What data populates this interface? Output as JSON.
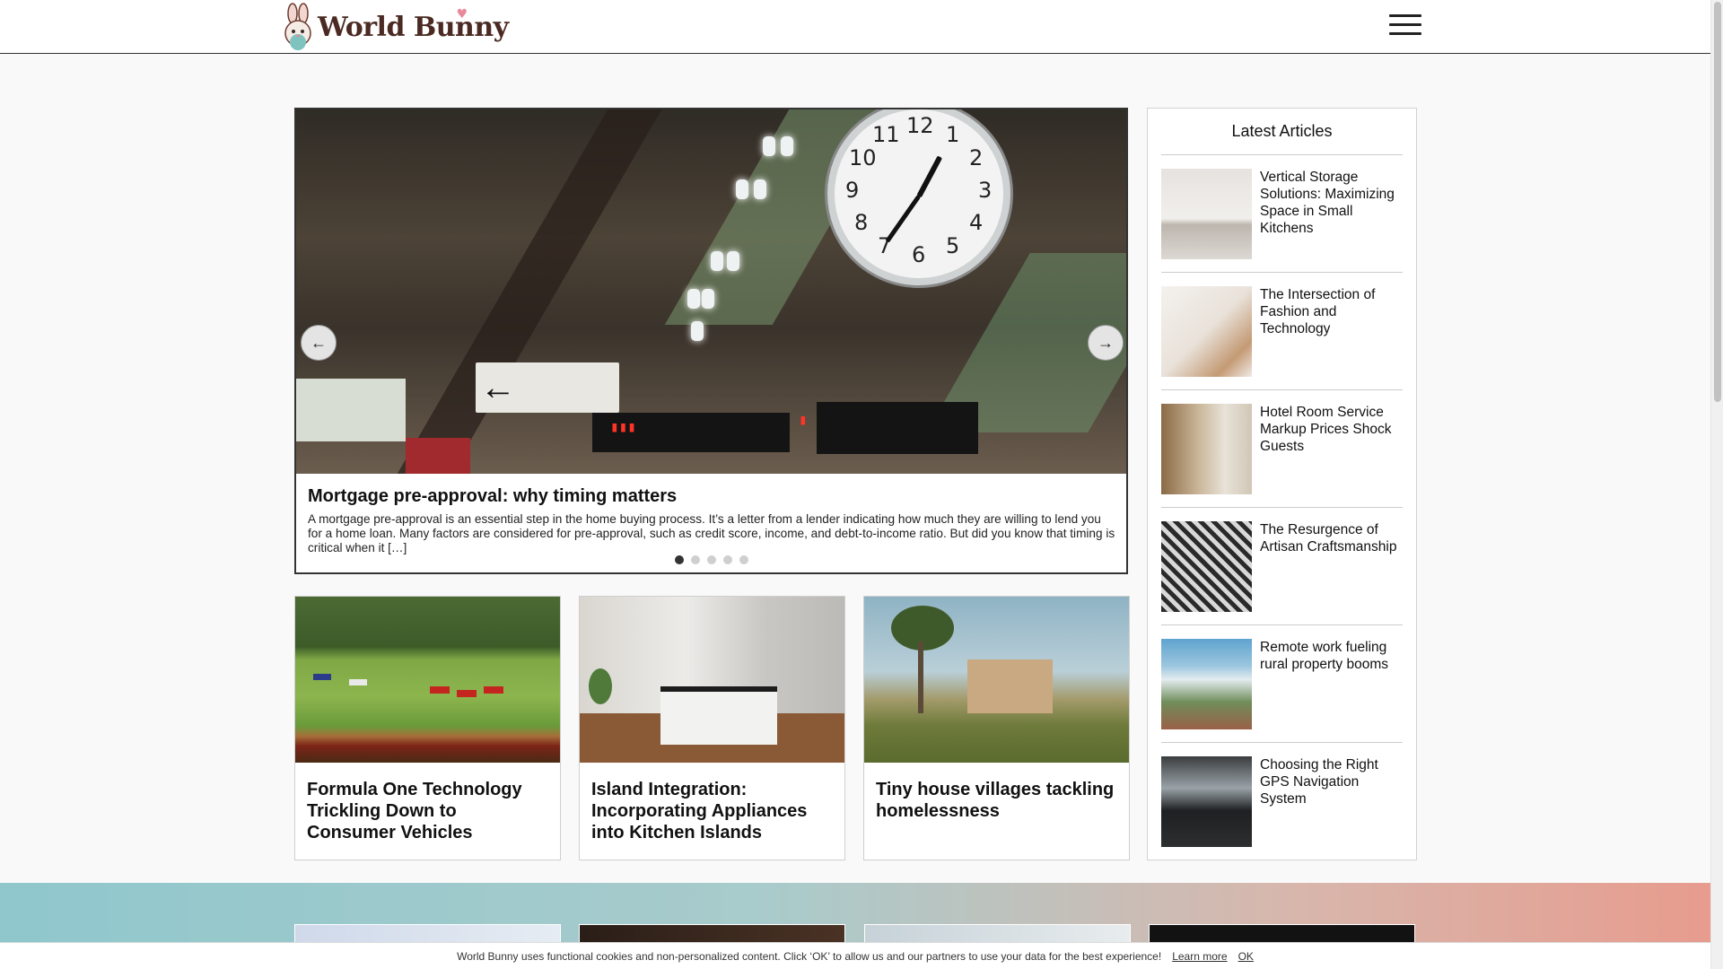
{
  "site": {
    "logo_text": "World Bunny",
    "menu_icon": "hamburger-menu-icon"
  },
  "slider": {
    "prev_label": "←",
    "next_label": "→",
    "title": "Mortgage pre-approval: why timing matters",
    "excerpt": "A mortgage pre-approval is an essential step in the home buying process. It’s a letter from a lender indicating how much they are willing to lend you for a home loan. Many factors are considered for pre-approval, such as credit score, income, and debt-to-income ratio. But did you know that timing is critical when it […]",
    "dot_count": 5,
    "active_dot": 0
  },
  "cards": [
    {
      "title": "Formula One Technology Trickling Down to Consumer Vehicles"
    },
    {
      "title": "Island Integration: Incorporating Appliances into Kitchen Islands"
    },
    {
      "title": "Tiny house villages tackling homelessness"
    }
  ],
  "sidebar": {
    "title": "Latest Articles",
    "items": [
      {
        "label": "Vertical Storage Solutions: Maximizing Space in Small Kitchens"
      },
      {
        "label": "The Intersection of Fashion and Technology"
      },
      {
        "label": "Hotel Room Service Markup Prices Shock Guests"
      },
      {
        "label": "The Resurgence of Artisan Craftsmanship"
      },
      {
        "label": "Remote work fueling rural property booms"
      },
      {
        "label": "Choosing the Right GPS Navigation System"
      }
    ]
  },
  "cookie": {
    "text": "World Bunny uses functional cookies and non-personalized content. Click ‘OK’ to allow us and our partners to use your data for the best experience!",
    "learn_more": "Learn more",
    "ok": "OK"
  }
}
